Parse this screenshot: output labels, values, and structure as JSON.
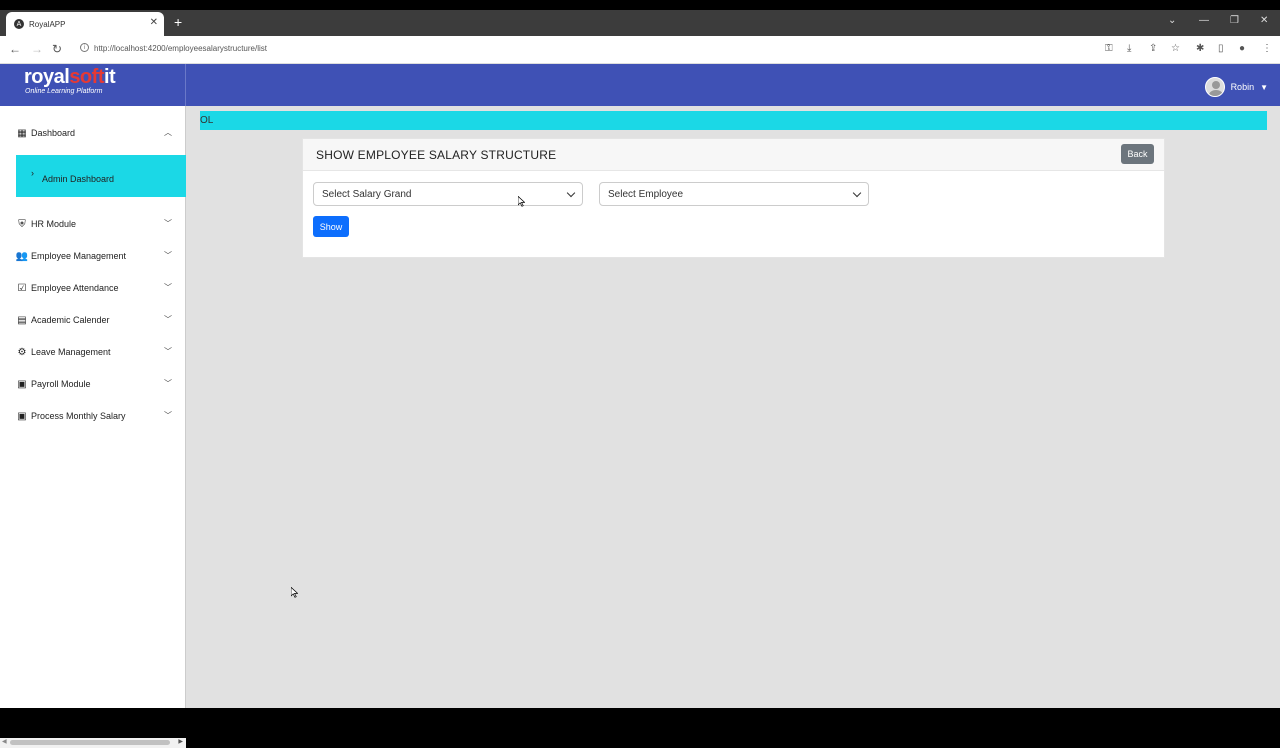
{
  "browser": {
    "tab_title": "RoyalAPP",
    "url": "http://localhost:4200/employeesalarystructure/list"
  },
  "brand": {
    "logo_part1": "royal",
    "logo_part2": "soft",
    "logo_part3": "it",
    "tagline": "Online Learning Platform"
  },
  "user": {
    "name": "Robin"
  },
  "sidebar": {
    "items": [
      {
        "label": "Dashboard",
        "icon": "dashboard-icon",
        "chevron": "up"
      },
      {
        "label": "HR Module",
        "icon": "hr-icon",
        "chevron": "down"
      },
      {
        "label": "Employee Management",
        "icon": "people-icon",
        "chevron": "down"
      },
      {
        "label": "Employee Attendance",
        "icon": "calendar-check-icon",
        "chevron": "down"
      },
      {
        "label": "Academic Calender",
        "icon": "calendar-icon",
        "chevron": "down"
      },
      {
        "label": "Leave Management",
        "icon": "gear-icon",
        "chevron": "down"
      },
      {
        "label": "Payroll Module",
        "icon": "money-icon",
        "chevron": "down"
      },
      {
        "label": "Process Monthly Salary",
        "icon": "money-icon",
        "chevron": "down"
      }
    ],
    "subitem": {
      "label": "Admin Dashboard"
    }
  },
  "marquee": {
    "text": "OL"
  },
  "card": {
    "title": "SHOW EMPLOYEE SALARY STRUCTURE",
    "back_label": "Back",
    "select_grade": "Select Salary Grand",
    "select_employee": "Select Employee",
    "show_label": "Show"
  },
  "colors": {
    "navbar": "#3f51b5",
    "accent_cyan": "#1bd8e6",
    "primary_button": "#0d6efd",
    "secondary_button": "#6c757d"
  }
}
